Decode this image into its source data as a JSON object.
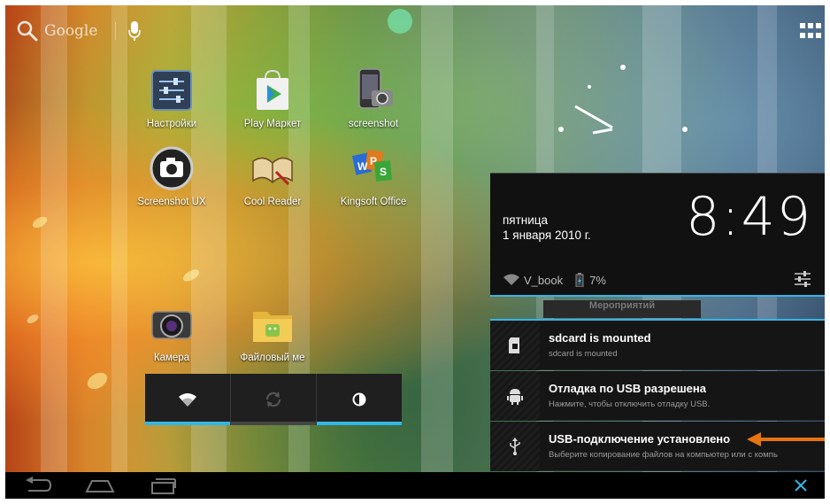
{
  "search": {
    "label": "Google"
  },
  "apps": [
    {
      "label": "Настройки",
      "icon": "settings-sliders-icon"
    },
    {
      "label": "Play Маркет",
      "icon": "play-store-icon"
    },
    {
      "label": "screenshot",
      "icon": "phone-camera-icon"
    },
    {
      "label": "Screenshot UX",
      "icon": "camera-round-icon"
    },
    {
      "label": "Cool Reader",
      "icon": "open-book-icon"
    },
    {
      "label": "Kingsoft Office",
      "icon": "wps-office-icon"
    },
    {
      "label": "Камера",
      "icon": "camera-lens-icon"
    },
    {
      "label": "Файловый ме",
      "icon": "file-manager-icon"
    }
  ],
  "clock_card": {
    "day": "пятница",
    "date": "1 января 2010 г.",
    "time": "8:49",
    "wifi_name": "V_book",
    "battery": "7%"
  },
  "events_tab": "Мероприятий",
  "notifications": [
    {
      "title": "sdcard is mounted",
      "subtitle": "sdcard is mounted",
      "icon": "sdcard-icon"
    },
    {
      "title": "Отладка по USB разрешена",
      "subtitle": "Нажмите, чтобы отключить отладку USB.",
      "icon": "android-debug-icon"
    },
    {
      "title": "USB-подключение установлено",
      "subtitle": "Выберите копирование файлов на компьютер или с компь",
      "icon": "usb-icon"
    }
  ],
  "colors": {
    "accent": "#33b5e5",
    "arrow": "#e8730f"
  }
}
